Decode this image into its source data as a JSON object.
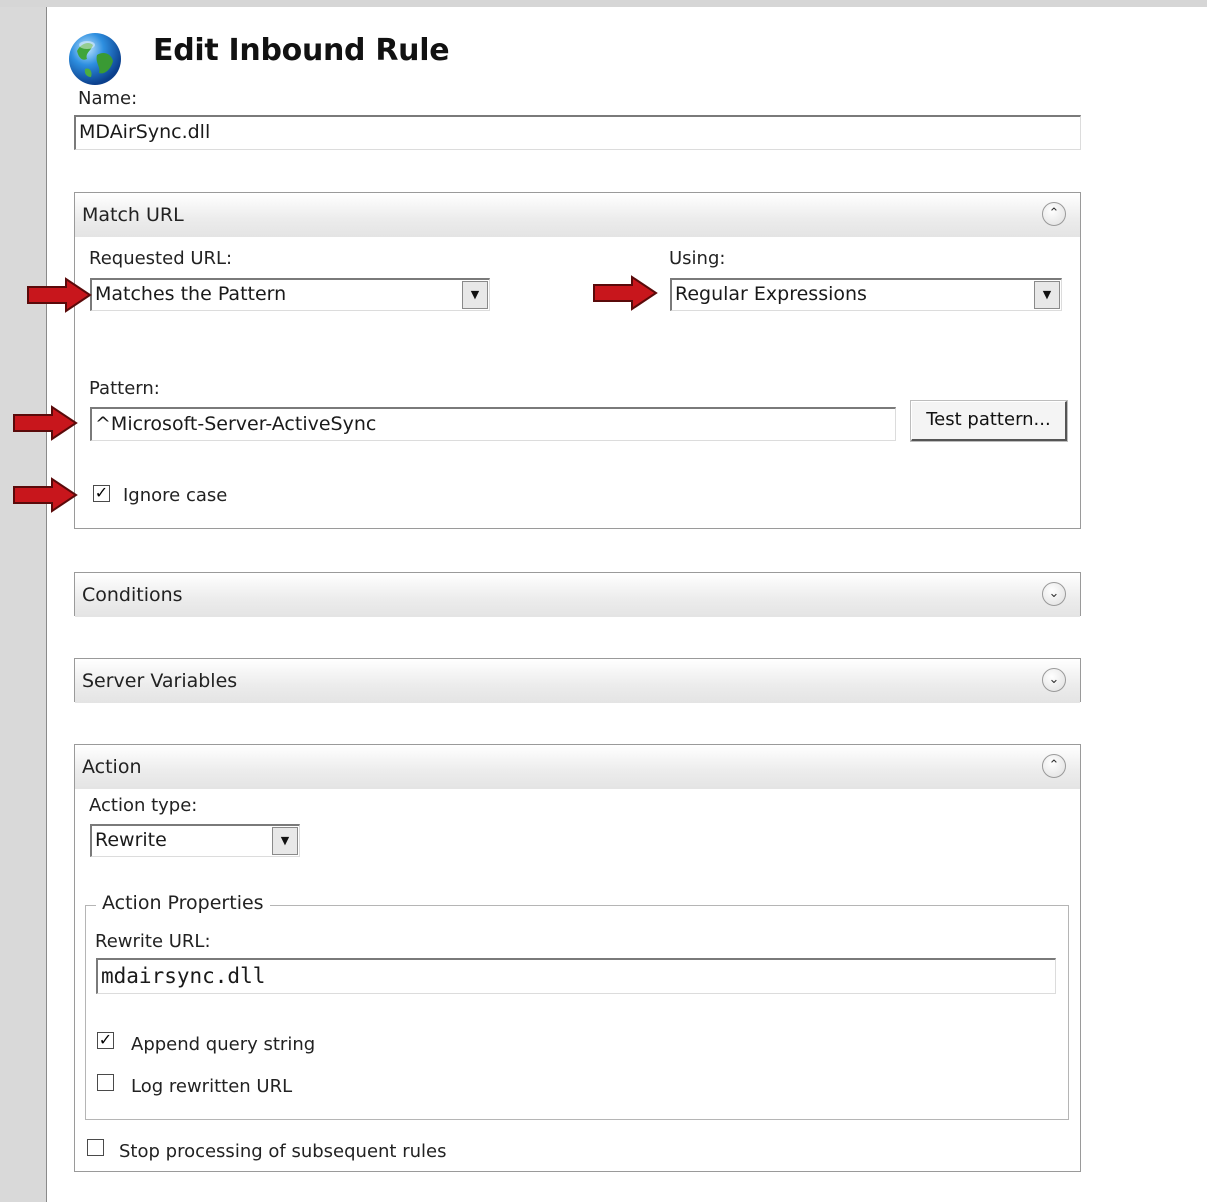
{
  "page": {
    "title": "Edit Inbound Rule",
    "name_label": "Name:",
    "name_value": "MDAirSync.dll"
  },
  "match_url": {
    "header": "Match URL",
    "requested_url_label": "Requested URL:",
    "requested_url_value": "Matches the Pattern",
    "using_label": "Using:",
    "using_value": "Regular Expressions",
    "pattern_label": "Pattern:",
    "pattern_value": "^Microsoft-Server-ActiveSync",
    "test_pattern_button": "Test pattern...",
    "ignore_case_label": "Ignore case",
    "ignore_case_checked": true
  },
  "conditions": {
    "header": "Conditions"
  },
  "server_variables": {
    "header": "Server Variables"
  },
  "action": {
    "header": "Action",
    "action_type_label": "Action type:",
    "action_type_value": "Rewrite",
    "properties_legend": "Action Properties",
    "rewrite_url_label": "Rewrite URL:",
    "rewrite_url_value": "mdairsync.dll",
    "append_query_label": "Append query string",
    "append_query_checked": true,
    "log_rewritten_label": "Log rewritten URL",
    "log_rewritten_checked": false,
    "stop_processing_label": "Stop processing of subsequent rules",
    "stop_processing_checked": false
  },
  "icons": {
    "globe": "globe-icon",
    "collapse": "chevron-up-icon",
    "expand": "chevron-down-icon",
    "dropdown": "dropdown-arrow-icon",
    "annotation_arrow": "red-arrow-icon"
  },
  "colors": {
    "annotation_arrow": "#c8161c",
    "header_gradient": "#e4e4e4",
    "panel_border": "#9a9a9a"
  }
}
